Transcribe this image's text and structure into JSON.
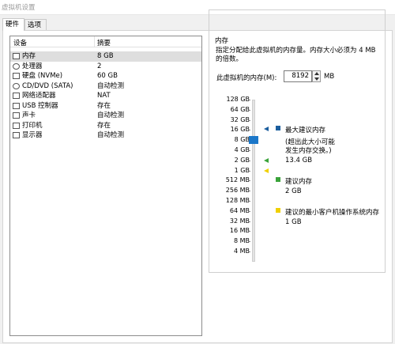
{
  "window": {
    "title": "虚拟机设置"
  },
  "tabs": [
    {
      "label": "硬件"
    },
    {
      "label": "选项"
    }
  ],
  "device_list": {
    "headers": {
      "device": "设备",
      "summary": "摘要"
    },
    "rows": [
      {
        "name": "内存",
        "value": "8 GB",
        "icon": "memory-icon"
      },
      {
        "name": "处理器",
        "value": "2",
        "icon": "processor-icon"
      },
      {
        "name": "硬盘 (NVMe)",
        "value": "60 GB",
        "icon": "hard-disk-icon"
      },
      {
        "name": "CD/DVD (SATA)",
        "value": "自动检测",
        "icon": "cd-dvd-icon"
      },
      {
        "name": "网络适配器",
        "value": "NAT",
        "icon": "network-adapter-icon"
      },
      {
        "name": "USB 控制器",
        "value": "存在",
        "icon": "usb-controller-icon"
      },
      {
        "name": "声卡",
        "value": "自动检测",
        "icon": "sound-card-icon"
      },
      {
        "name": "打印机",
        "value": "存在",
        "icon": "printer-icon"
      },
      {
        "name": "显示器",
        "value": "自动检测",
        "icon": "display-icon"
      }
    ]
  },
  "memory": {
    "group_title": "内存",
    "description_line1": "指定分配给此虚拟机的内存量。内存大小必须为 4 MB",
    "description_line2": "的倍数。",
    "field_label": "此虚拟机的内存(M):",
    "value": "8192",
    "unit": "MB",
    "scale_labels": [
      "128 GB",
      "64 GB",
      "32 GB",
      "16 GB",
      "8 GB",
      "4 GB",
      "2 GB",
      "1 GB",
      "512 MB",
      "256 MB",
      "128 MB",
      "64 MB",
      "32 MB",
      "16 MB",
      "8 MB",
      "4 MB"
    ],
    "selected_scale": "8 GB",
    "legend": {
      "max": {
        "label": "最大建议内存",
        "note_line1": "(超出此大小可能",
        "note_line2": "发生内存交换。)",
        "value": "13.4 GB",
        "color": "#1b5e9e"
      },
      "recommended": {
        "label": "建议内存",
        "value": "2 GB",
        "color": "#3aa33a"
      },
      "min": {
        "label": "建议的最小客户机操作系统内存",
        "value": "1 GB",
        "color": "#f0d000"
      }
    }
  }
}
